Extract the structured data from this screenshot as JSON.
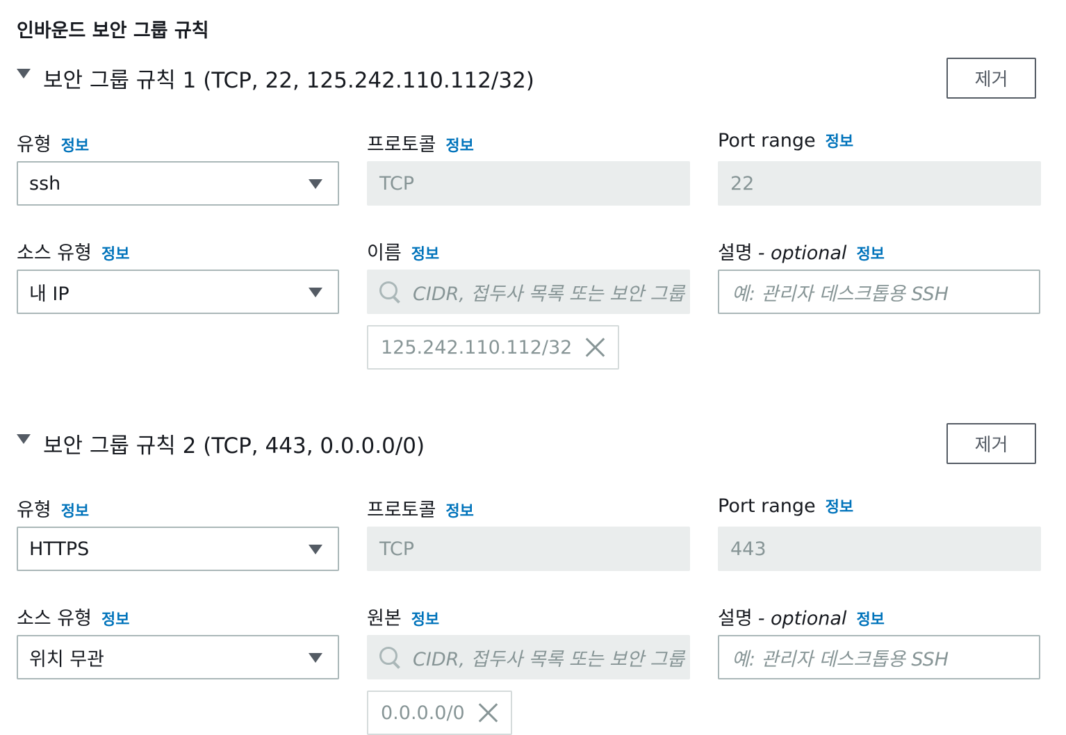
{
  "page_title": "인바운드 보안 그룹 규칙",
  "rules": [
    {
      "title": "보안 그룹 규칙 1 (TCP, 22, 125.242.110.112/32)",
      "remove_label": "제거",
      "type_label": "유형",
      "type_value": "ssh",
      "protocol_label": "프로토콜",
      "protocol_value": "TCP",
      "port_label": "Port range",
      "port_value": "22",
      "source_type_label": "소스 유형",
      "source_type_value": "내 IP",
      "source_label": "이름",
      "source_placeholder": "CIDR, 접두사 목록 또는 보안 그룹",
      "source_token": "125.242.110.112/32",
      "desc_label": "설명",
      "desc_optional": "- optional",
      "desc_placeholder": "예: 관리자 데스크톱용 SSH"
    },
    {
      "title": "보안 그룹 규칙 2 (TCP, 443, 0.0.0.0/0)",
      "remove_label": "제거",
      "type_label": "유형",
      "type_value": "HTTPS",
      "protocol_label": "프로토콜",
      "protocol_value": "TCP",
      "port_label": "Port range",
      "port_value": "443",
      "source_type_label": "소스 유형",
      "source_type_value": "위치 무관",
      "source_label": "원본",
      "source_placeholder": "CIDR, 접두사 목록 또는 보안 그룹",
      "source_token": "0.0.0.0/0",
      "desc_label": "설명",
      "desc_optional": "- optional",
      "desc_placeholder": "예: 관리자 데스크톱용 SSH"
    }
  ],
  "info_label": "정보",
  "icons": {
    "caret": "caret-down-icon",
    "dropdown": "dropdown-arrow-icon",
    "search": "search-icon",
    "close": "close-icon"
  },
  "colors": {
    "info_link": "#0073bb",
    "disabled_bg": "#eaeded",
    "border": "#aab7b8",
    "text": "#16191f",
    "muted": "#879596"
  }
}
